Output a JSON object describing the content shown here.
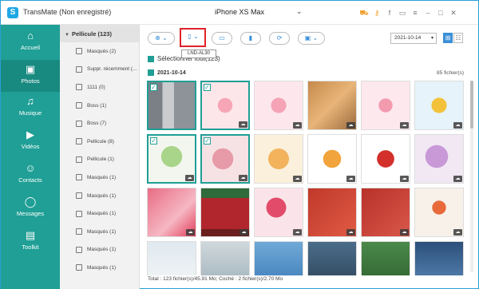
{
  "app": {
    "title": "TransMate (Non enregistré)",
    "logo": "S"
  },
  "device": {
    "name": "iPhone XS Max"
  },
  "window_icons": [
    "cart-icon",
    "key-icon",
    "facebook-icon",
    "chat-icon",
    "menu-icon",
    "minimize-icon",
    "maximize-icon",
    "close-icon"
  ],
  "sidebar": {
    "items": [
      {
        "label": "Accueil",
        "icon": "home-icon"
      },
      {
        "label": "Photos",
        "icon": "photos-icon"
      },
      {
        "label": "Musique",
        "icon": "music-icon"
      },
      {
        "label": "Vidéos",
        "icon": "video-icon"
      },
      {
        "label": "Contacts",
        "icon": "contacts-icon"
      },
      {
        "label": "Messages",
        "icon": "messages-icon"
      },
      {
        "label": "Toolkit",
        "icon": "toolkit-icon"
      }
    ],
    "active": "Photos"
  },
  "albums": {
    "header": "Pellicule (123)",
    "items": [
      "Masqués (2)",
      "Suppr. récemment (...",
      "1111 (0)",
      "Boss (1)",
      "Boss (7)",
      "Pellicule (8)",
      "Pellicule (1)",
      "Masqués (1)",
      "Masqués (1)",
      "Masqués (1)",
      "Masqués (1)",
      "Masqués (1)",
      "Masqués (1)"
    ]
  },
  "toolbar": {
    "tooltip": "LND-AL30",
    "date_value": "2021-10-14",
    "select_all": "Sélectionner tout(123)"
  },
  "group": {
    "date": "2021-10-14",
    "count": "85 fichier(s)"
  },
  "status": "Total : 123 fichier(s)/45.91 Mo; Coché : 2 fichier(s)/2.70 Mo",
  "colors": {
    "accent": "#1f9f95",
    "highlight": "#e0222a",
    "brand": "#1ea7e4"
  }
}
